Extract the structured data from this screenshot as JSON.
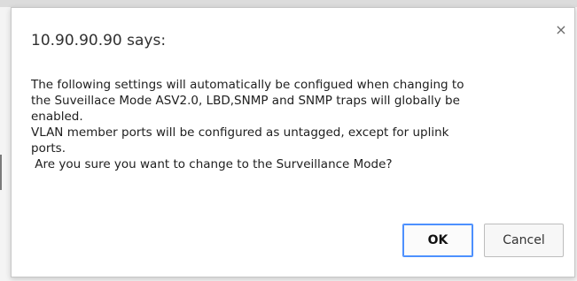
{
  "dialog": {
    "title": "10.90.90.90 says:",
    "close_symbol": "×",
    "message_lines": [
      "The following settings will automatically be configued when changing to",
      "the Suveillace Mode ASV2.0, LBD,SNMP and SNMP traps will globally be",
      "enabled.",
      "VLAN member ports will be configured as untagged, except for uplink",
      "ports.",
      " Are you sure you want to change to the Surveillance Mode?"
    ],
    "ok_label": "OK",
    "cancel_label": "Cancel"
  },
  "icons": {
    "close": "close-icon"
  },
  "colors": {
    "ok_focus_border": "#4d90fe",
    "dialog_border": "#c7c7c7"
  }
}
